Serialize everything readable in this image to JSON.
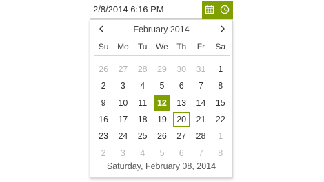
{
  "input": {
    "value": "2/8/2014 6:16 PM",
    "calendar_button_icon": "calendar-icon",
    "time_button_icon": "clock-icon"
  },
  "calendar": {
    "title": "February 2014",
    "prev_icon": "chevron-left-icon",
    "next_icon": "chevron-right-icon",
    "weekdays": [
      "Su",
      "Mo",
      "Tu",
      "We",
      "Th",
      "Fr",
      "Sa"
    ],
    "weeks": [
      [
        {
          "d": "26",
          "o": true
        },
        {
          "d": "27",
          "o": true
        },
        {
          "d": "28",
          "o": true
        },
        {
          "d": "29",
          "o": true
        },
        {
          "d": "30",
          "o": true
        },
        {
          "d": "31",
          "o": true
        },
        {
          "d": "1"
        }
      ],
      [
        {
          "d": "2"
        },
        {
          "d": "3"
        },
        {
          "d": "4"
        },
        {
          "d": "5"
        },
        {
          "d": "6"
        },
        {
          "d": "7"
        },
        {
          "d": "8"
        }
      ],
      [
        {
          "d": "9"
        },
        {
          "d": "10"
        },
        {
          "d": "11"
        },
        {
          "d": "12",
          "selected": true
        },
        {
          "d": "13"
        },
        {
          "d": "14"
        },
        {
          "d": "15"
        }
      ],
      [
        {
          "d": "16"
        },
        {
          "d": "17"
        },
        {
          "d": "18"
        },
        {
          "d": "19"
        },
        {
          "d": "20",
          "today": true
        },
        {
          "d": "21"
        },
        {
          "d": "22"
        }
      ],
      [
        {
          "d": "23"
        },
        {
          "d": "24"
        },
        {
          "d": "25"
        },
        {
          "d": "26"
        },
        {
          "d": "27"
        },
        {
          "d": "28"
        },
        {
          "d": "1",
          "o": true
        }
      ],
      [
        {
          "d": "2",
          "o": true
        },
        {
          "d": "3",
          "o": true
        },
        {
          "d": "4",
          "o": true
        },
        {
          "d": "5",
          "o": true
        },
        {
          "d": "6",
          "o": true
        },
        {
          "d": "7",
          "o": true
        },
        {
          "d": "8",
          "o": true
        }
      ]
    ],
    "footer": "Saturday, February 08, 2014"
  },
  "colors": {
    "accent": "#7fa000",
    "text": "#333333",
    "muted": "#b6b6b6"
  }
}
